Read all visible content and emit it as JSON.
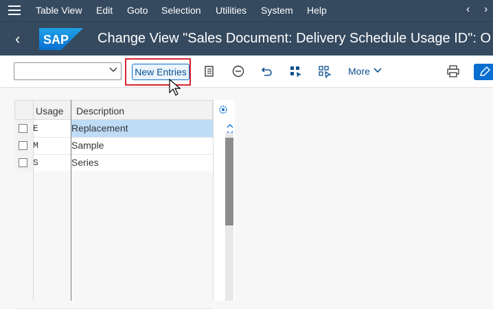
{
  "menubar": {
    "items": [
      "Table View",
      "Edit",
      "Goto",
      "Selection",
      "Utilities",
      "System",
      "Help"
    ]
  },
  "titlebar": {
    "logo_text": "SAP",
    "title": "Change View \"Sales Document: Delivery Schedule Usage ID\": O"
  },
  "toolbar": {
    "combo_value": "",
    "new_entries_label": "New Entries",
    "more_label": "More"
  },
  "table": {
    "columns": [
      "Usage",
      "Description"
    ],
    "rows": [
      {
        "usage": "E",
        "description": "Replacement",
        "selected": true
      },
      {
        "usage": "M",
        "description": "Sample",
        "selected": false
      },
      {
        "usage": "S",
        "description": "Series",
        "selected": false
      }
    ]
  },
  "colors": {
    "shell": "#354a5f",
    "accent": "#0a6ed1",
    "highlight": "#d9232f",
    "selection": "#bfdcf6"
  }
}
